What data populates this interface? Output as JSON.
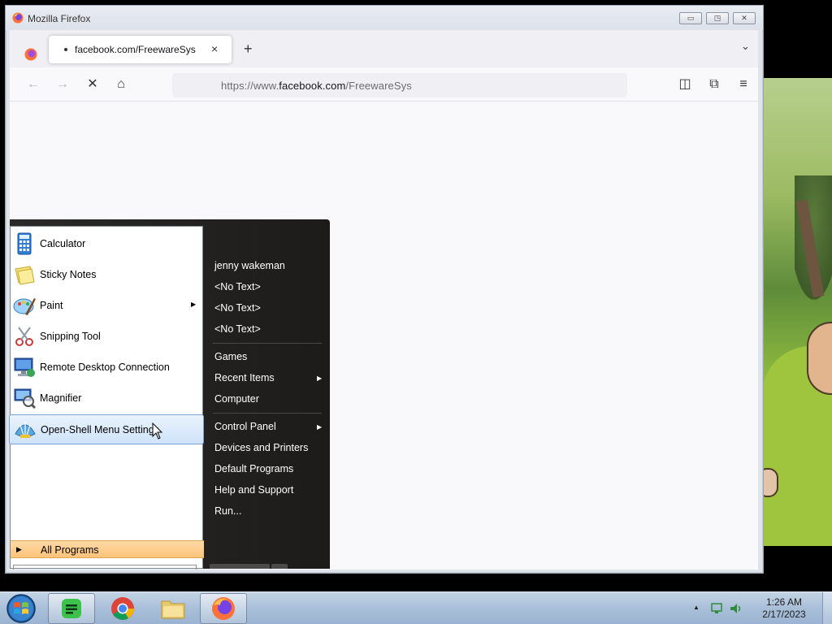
{
  "browser": {
    "window_title": "Mozilla Firefox",
    "tab_title": "facebook.com/FreewareSys",
    "tab_close": "×",
    "new_tab": "+",
    "list_all_tabs": "⌄",
    "url_prefix": "https://www.",
    "url_host": "facebook.com",
    "url_path": "/FreewareSys",
    "nav": {
      "back": "←",
      "forward": "→",
      "stop": "✕",
      "home": "⌂",
      "pocket": "◫",
      "extensions": "⧉",
      "menu": "≡"
    }
  },
  "start_menu": {
    "programs": [
      {
        "label": "Calculator",
        "icon": "calculator-icon",
        "has_submenu": false
      },
      {
        "label": "Sticky Notes",
        "icon": "sticky-notes-icon",
        "has_submenu": false
      },
      {
        "label": "Paint",
        "icon": "paint-icon",
        "has_submenu": true
      },
      {
        "label": "Snipping Tool",
        "icon": "snipping-tool-icon",
        "has_submenu": false
      },
      {
        "label": "Remote Desktop Connection",
        "icon": "remote-desktop-icon",
        "has_submenu": false
      },
      {
        "label": "Magnifier",
        "icon": "magnifier-icon",
        "has_submenu": false
      },
      {
        "label": "Open-Shell Menu Settings",
        "icon": "open-shell-icon",
        "has_submenu": false,
        "highlighted": true
      }
    ],
    "all_programs": "All Programs",
    "right_items": [
      {
        "label": "jenny wakeman"
      },
      {
        "label": "<No Text>"
      },
      {
        "label": "<No Text>"
      },
      {
        "label": "<No Text>"
      },
      {
        "label": "Games"
      },
      {
        "label": "Recent Items",
        "has_submenu": true
      },
      {
        "label": "Computer"
      },
      {
        "label": "Control Panel",
        "has_submenu": true
      },
      {
        "label": "Devices and Printers"
      },
      {
        "label": "Default Programs"
      },
      {
        "label": "Help and Support"
      },
      {
        "label": "Run..."
      }
    ]
  },
  "taskbar": {
    "apps": [
      {
        "name": "notes-app",
        "icon": "green-notes-icon"
      },
      {
        "name": "chrome",
        "icon": "chrome-icon"
      },
      {
        "name": "explorer",
        "icon": "folder-icon"
      },
      {
        "name": "firefox",
        "icon": "firefox-icon",
        "active": true
      }
    ],
    "clock_time": "1:26 AM",
    "clock_date": "2/17/2023"
  }
}
